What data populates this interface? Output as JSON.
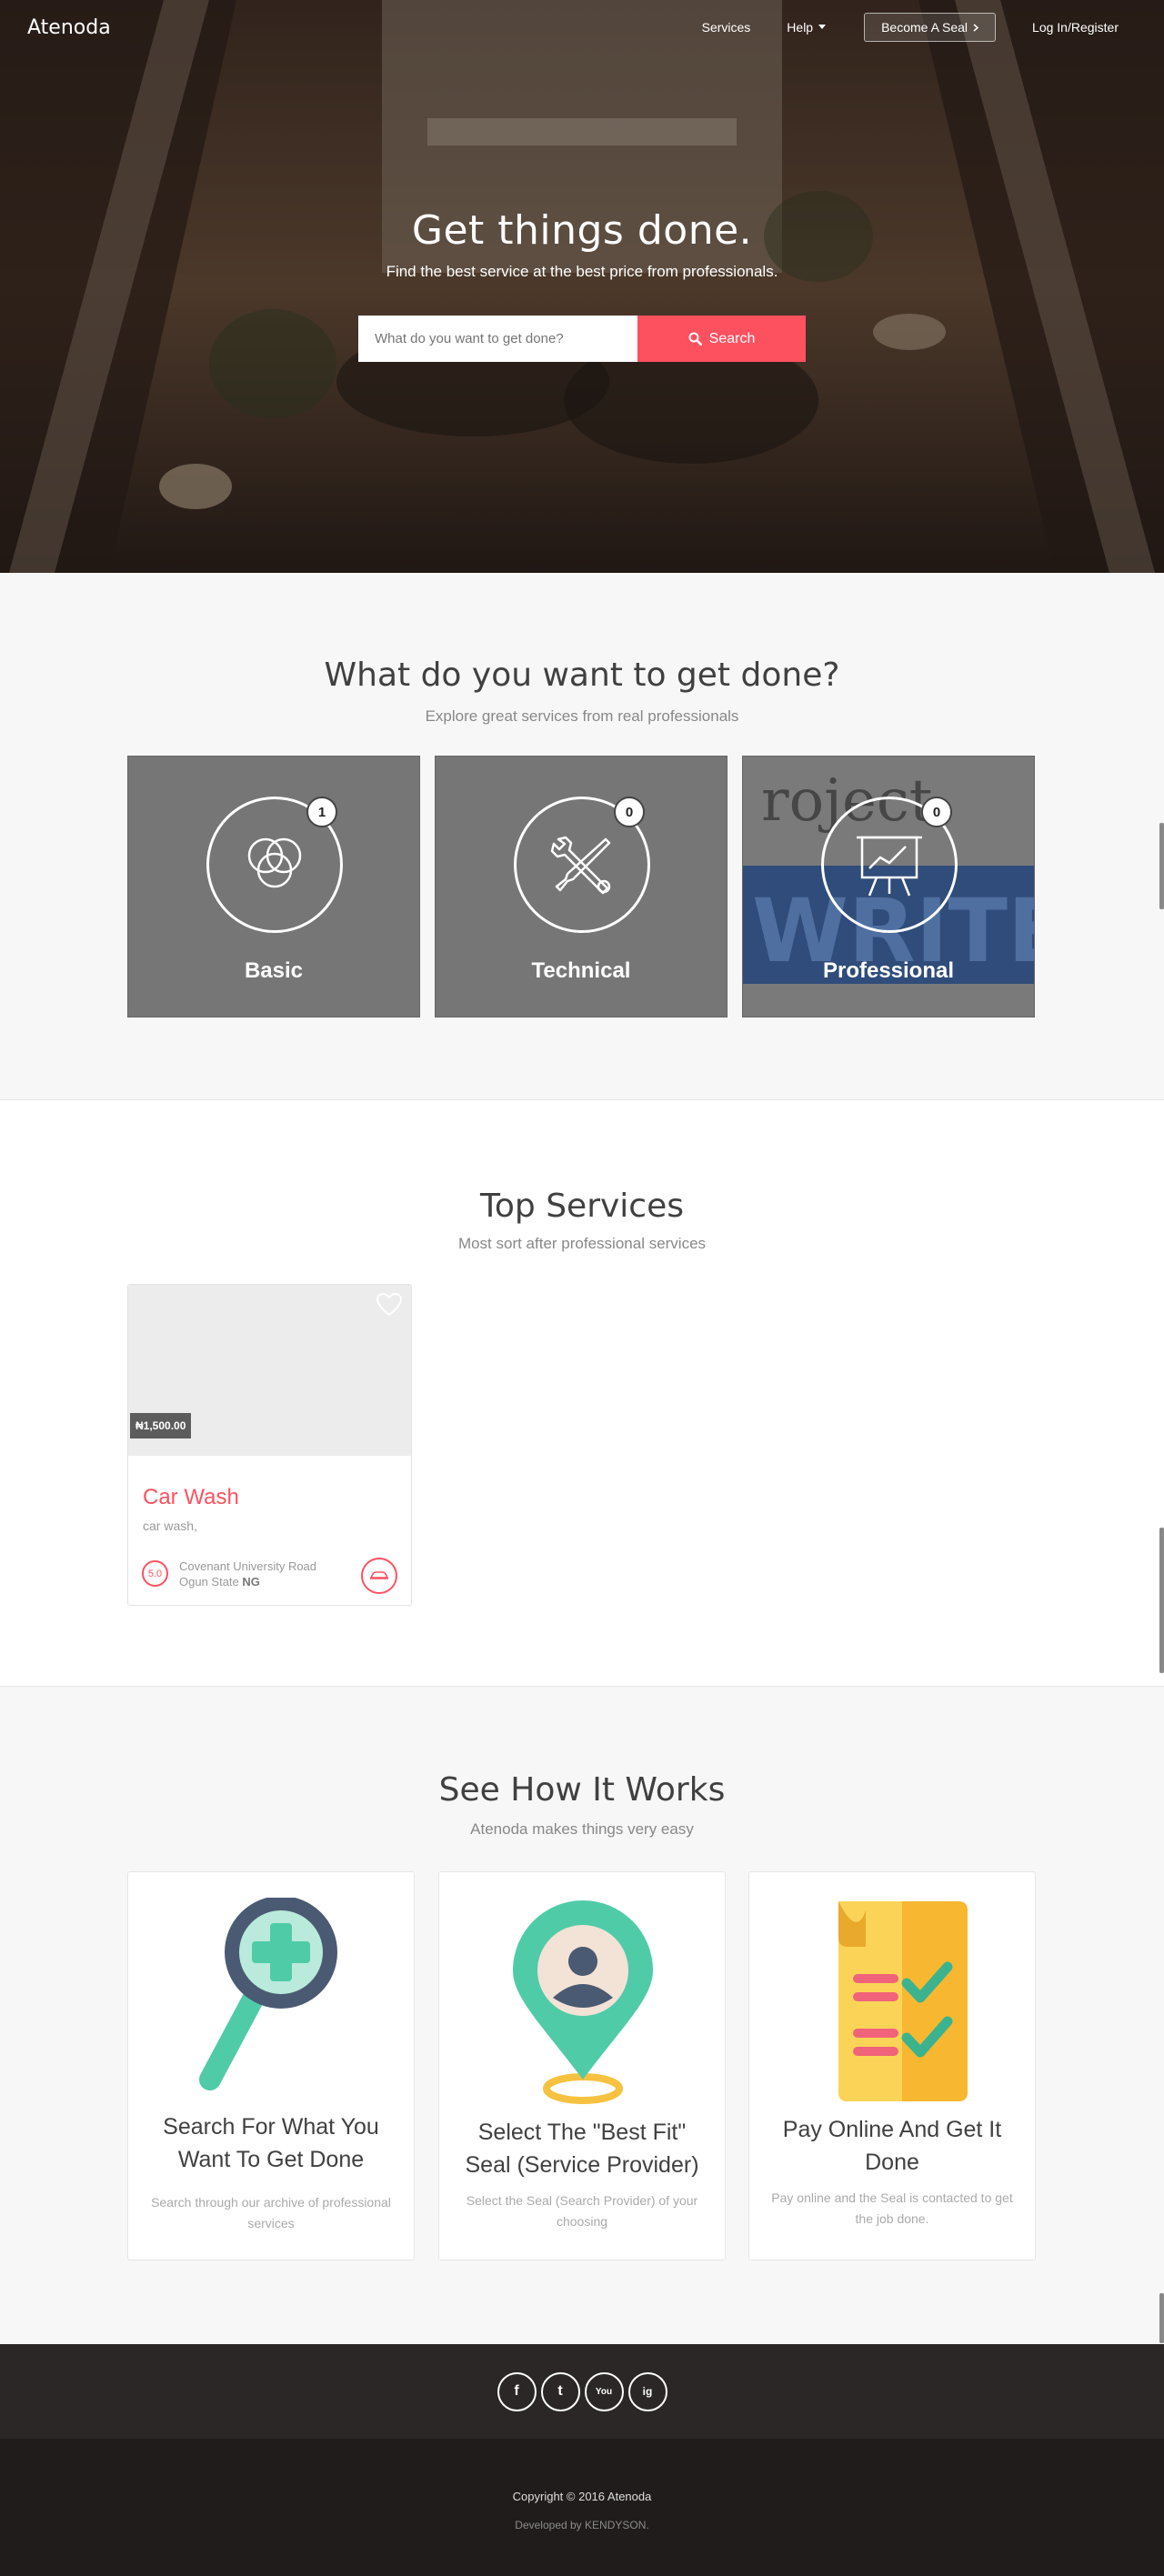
{
  "nav": {
    "logo": "Atenoda",
    "services": "Services",
    "help": "Help",
    "become_seal": "Become A Seal",
    "login": "Log In/Register"
  },
  "hero": {
    "title": "Get things done.",
    "subtitle": "Find the best service at the best price from professionals.",
    "search_placeholder": "What do you want to get done?",
    "search_button": "Search"
  },
  "categories": {
    "title": "What do you want to get done?",
    "subtitle": "Explore great services from real professionals",
    "items": [
      {
        "label": "Basic",
        "count": "1",
        "icon": "overlapping-circles-icon"
      },
      {
        "label": "Technical",
        "count": "0",
        "icon": "wrench-screwdriver-icon"
      },
      {
        "label": "Professional",
        "count": "0",
        "icon": "presentation-board-icon"
      }
    ]
  },
  "top_services": {
    "title": "Top Services",
    "subtitle": "Most sort after professional services",
    "items": [
      {
        "name": "Car Wash",
        "description": "car wash,",
        "price": "₦1,500.00",
        "rating": "5.0",
        "location_line1": "Covenant University Road",
        "location_state": "Ogun State",
        "location_country": "NG"
      }
    ]
  },
  "how": {
    "title": "See How It Works",
    "subtitle": "Atenoda makes things very easy",
    "steps": [
      {
        "title": "Search For What You Want To Get Done",
        "desc": "Search through our archive of professional services",
        "icon": "magnifier-plus-icon"
      },
      {
        "title": "Select The \"Best Fit\" Seal (Service Provider)",
        "desc": "Select the Seal (Search Provider) of your choosing",
        "icon": "location-pin-user-icon"
      },
      {
        "title": "Pay Online And Get It Done",
        "desc": "Pay online and the Seal is contacted to get the job done.",
        "icon": "checklist-document-icon"
      }
    ]
  },
  "footer": {
    "social": [
      "f",
      "t",
      "You",
      "ig"
    ],
    "copyright": "Copyright © 2016 Atenoda",
    "developer": "Developed by KENDYSON."
  },
  "colors": {
    "accent": "#fd5160",
    "footer_top": "#2b2727",
    "footer_bottom": "#211c1c"
  }
}
